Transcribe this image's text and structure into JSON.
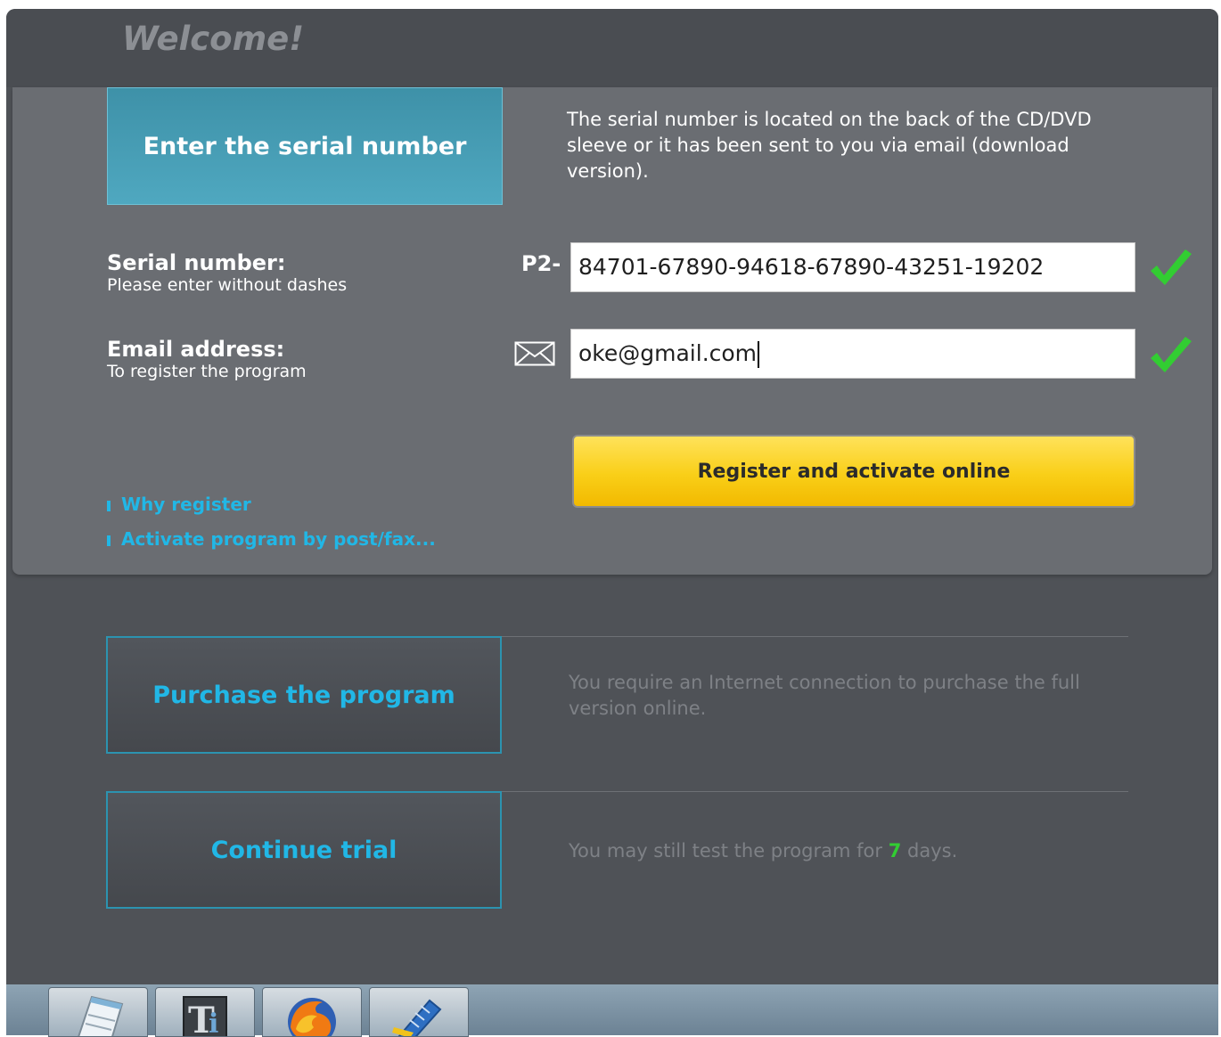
{
  "window": {
    "title": "Welcome!"
  },
  "serial_section": {
    "tab_label": "Enter the serial number",
    "info": "The serial number is located on the back of the CD/DVD sleeve or it has been sent to you via email (download version).",
    "serial_label": "Serial number:",
    "serial_hint": "Please enter without dashes",
    "serial_prefix": "P2-",
    "serial_value": "84701-67890-94618-67890-43251-19202",
    "email_label": "Email address:",
    "email_hint": "To register the program",
    "email_value": "oke@gmail.com",
    "register_button": "Register and activate online",
    "links": [
      "Why register",
      "Activate program by post/fax..."
    ]
  },
  "purchase": {
    "button": "Purchase the program",
    "info": "You require an Internet connection to purchase the full version online."
  },
  "trial": {
    "button": "Continue trial",
    "info_prefix": "You may still test the program for",
    "days": "7",
    "info_suffix": "days."
  },
  "colors": {
    "accent": "#21b7e6",
    "register": "#f9cf18",
    "check": "#32cd32",
    "window_bg": "#4f5257",
    "panel_bg": "#6a6d72"
  },
  "taskbar": {
    "icons": [
      "notepad-icon",
      "typography-app-icon",
      "firefox-icon",
      "pen-ruler-icon"
    ]
  }
}
